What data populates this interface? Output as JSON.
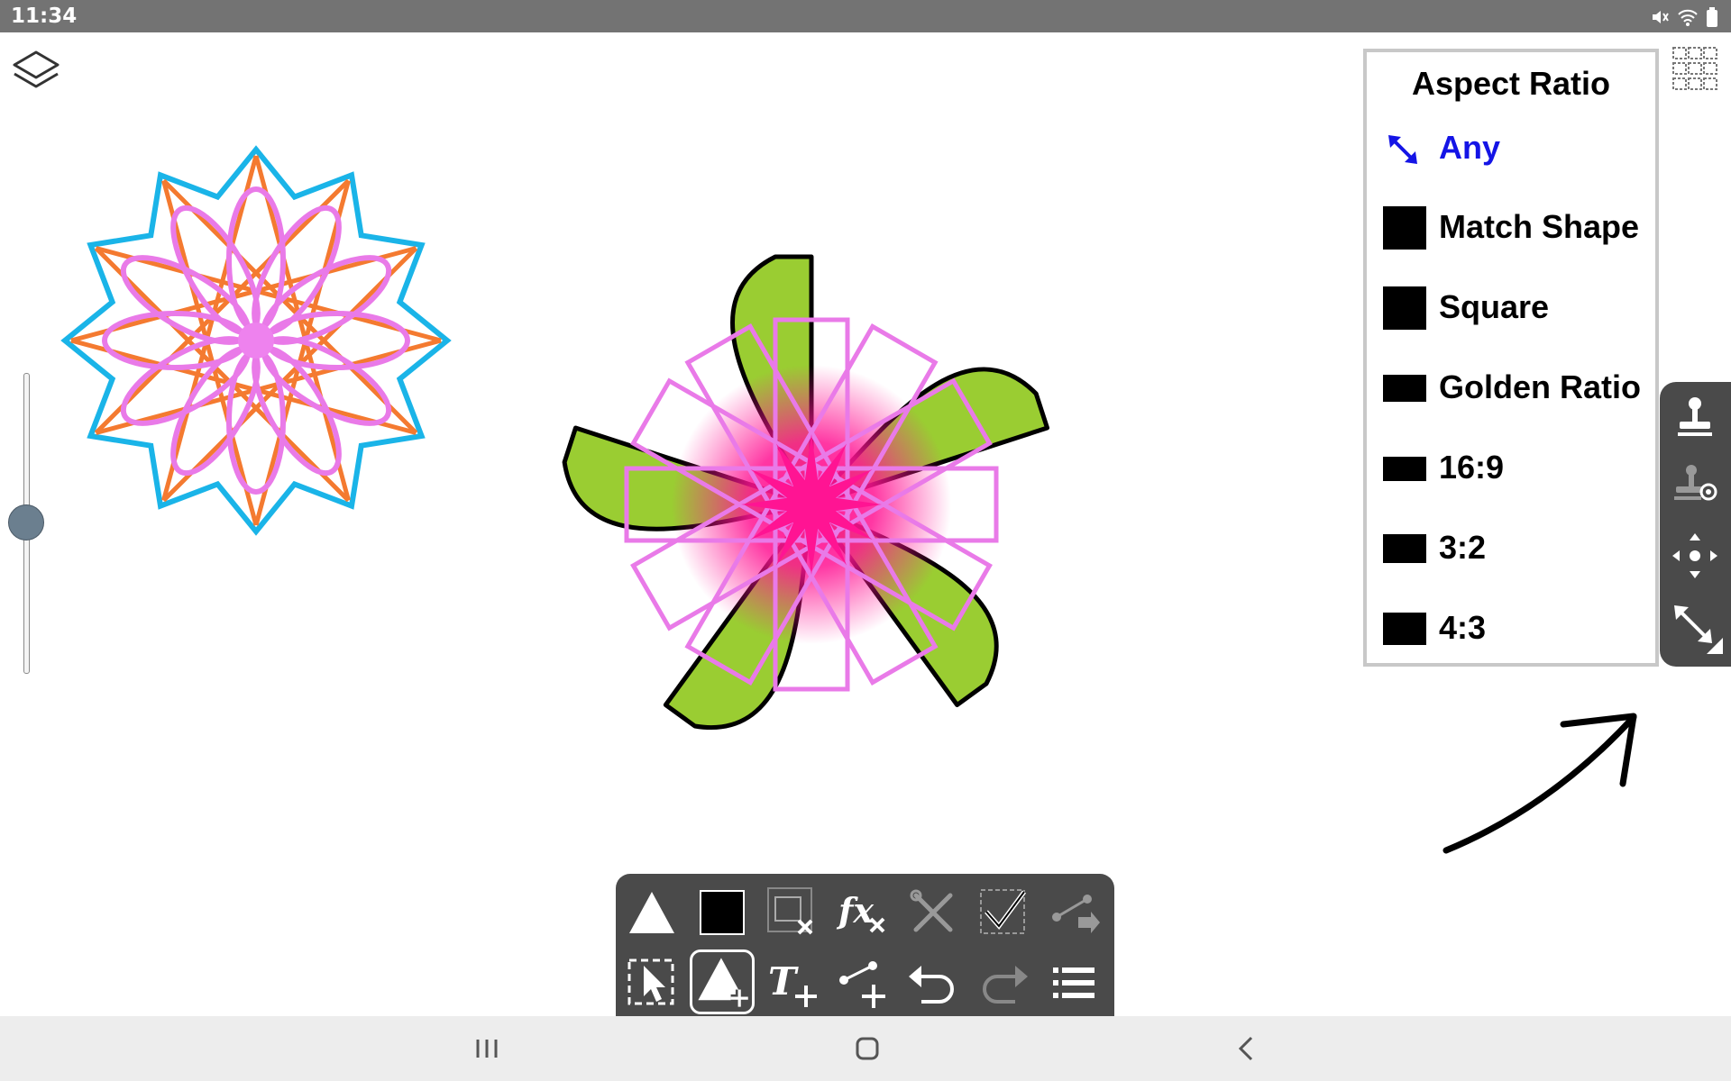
{
  "status_bar": {
    "time": "11:34",
    "icons": [
      "mute-icon",
      "wifi-icon",
      "battery-icon"
    ]
  },
  "aspect_ratio_panel": {
    "title": "Aspect Ratio",
    "selected": "Any",
    "items": [
      {
        "label": "Any",
        "icon": "resize-diagonal-icon"
      },
      {
        "label": "Match Shape",
        "icon": "swatch-match-shape"
      },
      {
        "label": "Square",
        "icon": "swatch-square"
      },
      {
        "label": "Golden Ratio",
        "icon": "swatch-golden-ratio"
      },
      {
        "label": "16:9",
        "icon": "swatch-16-9"
      },
      {
        "label": "3:2",
        "icon": "swatch-3-2"
      },
      {
        "label": "4:3",
        "icon": "swatch-4-3"
      }
    ]
  },
  "right_toolbar": {
    "buttons": [
      "stamp-icon",
      "stamp-settings-icon",
      "move-icon",
      "resize-icon"
    ]
  },
  "bottom_toolbar": {
    "row1": [
      "shape-triangle-icon",
      "fill-color-icon",
      "delete-selection-icon",
      "effects-icon",
      "tools-icon",
      "confirm-selection-icon",
      "export-path-icon"
    ],
    "row2": [
      "select-icon",
      "add-shape-icon",
      "add-text-icon",
      "add-path-icon",
      "undo-icon",
      "redo-icon",
      "menu-icon"
    ],
    "active": "add-shape-icon"
  },
  "navigation_bar": {
    "buttons": [
      "recent-apps-icon",
      "home-icon",
      "back-icon"
    ]
  },
  "colors": {
    "status_bar": "#737373",
    "toolbar": "#4a4a4a",
    "selected_option": "#1414e6",
    "star_outline": "#1ab4e8",
    "star_orange": "#f47a30",
    "petal_pink": "#e97ae8",
    "leaf_green": "#9acd32",
    "glow_magenta": "#ff1493"
  }
}
